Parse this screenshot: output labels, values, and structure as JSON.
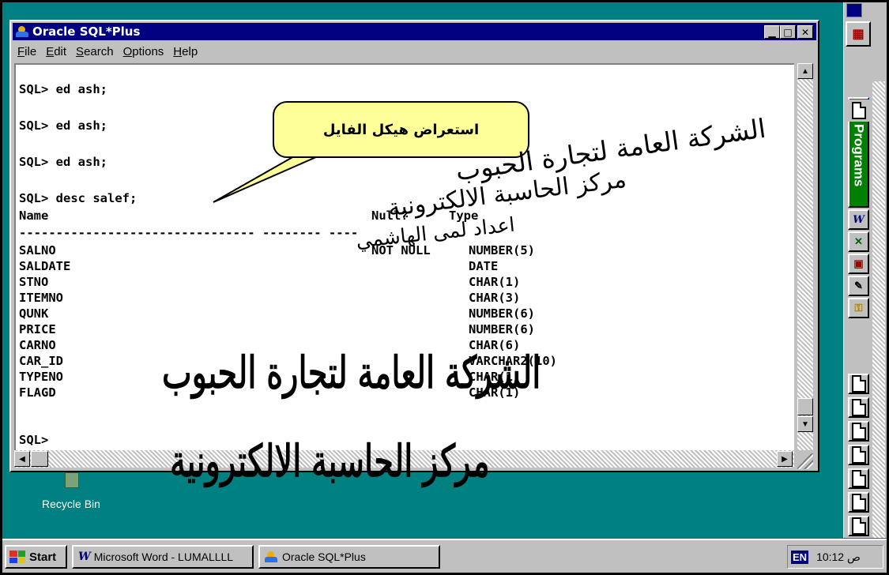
{
  "window": {
    "title": "Oracle SQL*Plus",
    "menu": [
      "File",
      "Edit",
      "Search",
      "Options",
      "Help"
    ]
  },
  "console": {
    "lines": [
      "SQL> ed ash;",
      "SQL> ed ash;",
      "SQL> ed ash;",
      "SQL> desc salef;"
    ],
    "headers": {
      "name": "Name",
      "null": "Null?",
      "type": "Type"
    },
    "separator": "-------------------------------- -------- ----",
    "rows": [
      {
        "name": "SALNO",
        "null": "NOT NULL",
        "type": "NUMBER(5)"
      },
      {
        "name": "SALDATE",
        "null": "",
        "type": "DATE"
      },
      {
        "name": "STNO",
        "null": "",
        "type": "CHAR(1)"
      },
      {
        "name": "ITEMNO",
        "null": "",
        "type": "CHAR(3)"
      },
      {
        "name": "QUNK",
        "null": "",
        "type": "NUMBER(6)"
      },
      {
        "name": "PRICE",
        "null": "",
        "type": "NUMBER(6)"
      },
      {
        "name": "CARNO",
        "null": "",
        "type": "CHAR(6)"
      },
      {
        "name": "CAR_ID",
        "null": "",
        "type": "VARCHAR2(10)"
      },
      {
        "name": "TYPENO",
        "null": "",
        "type": "CHAR(1)"
      },
      {
        "name": "FLAGD",
        "null": "",
        "type": "CHAR(1)"
      }
    ],
    "prompt": "SQL>"
  },
  "callout": {
    "text": "استعراض هيكل الفايل"
  },
  "overlay": {
    "company": "الشركة العامة لتجارة الحبوب",
    "center": "مركز الحاسبة الالكترونية",
    "prepared_by": "اعداد لمى الهاشمي",
    "big_company": "الشركة العامة لتجارة الحبوب",
    "big_center": "مركز الحاسبة الالكترونية"
  },
  "desktop": {
    "recycle_bin": "Recycle Bin"
  },
  "office_bar": {
    "programs": "Programs"
  },
  "taskbar": {
    "start": "Start",
    "tasks": [
      "Microsoft Word - LUMALLLL",
      "Oracle SQL*Plus"
    ],
    "lang": "EN",
    "clock": "10:12 ص"
  },
  "colors": {
    "titlebar": "#000080",
    "desktop": "#008080",
    "callout": "#ffff99",
    "programs": "#008000"
  }
}
